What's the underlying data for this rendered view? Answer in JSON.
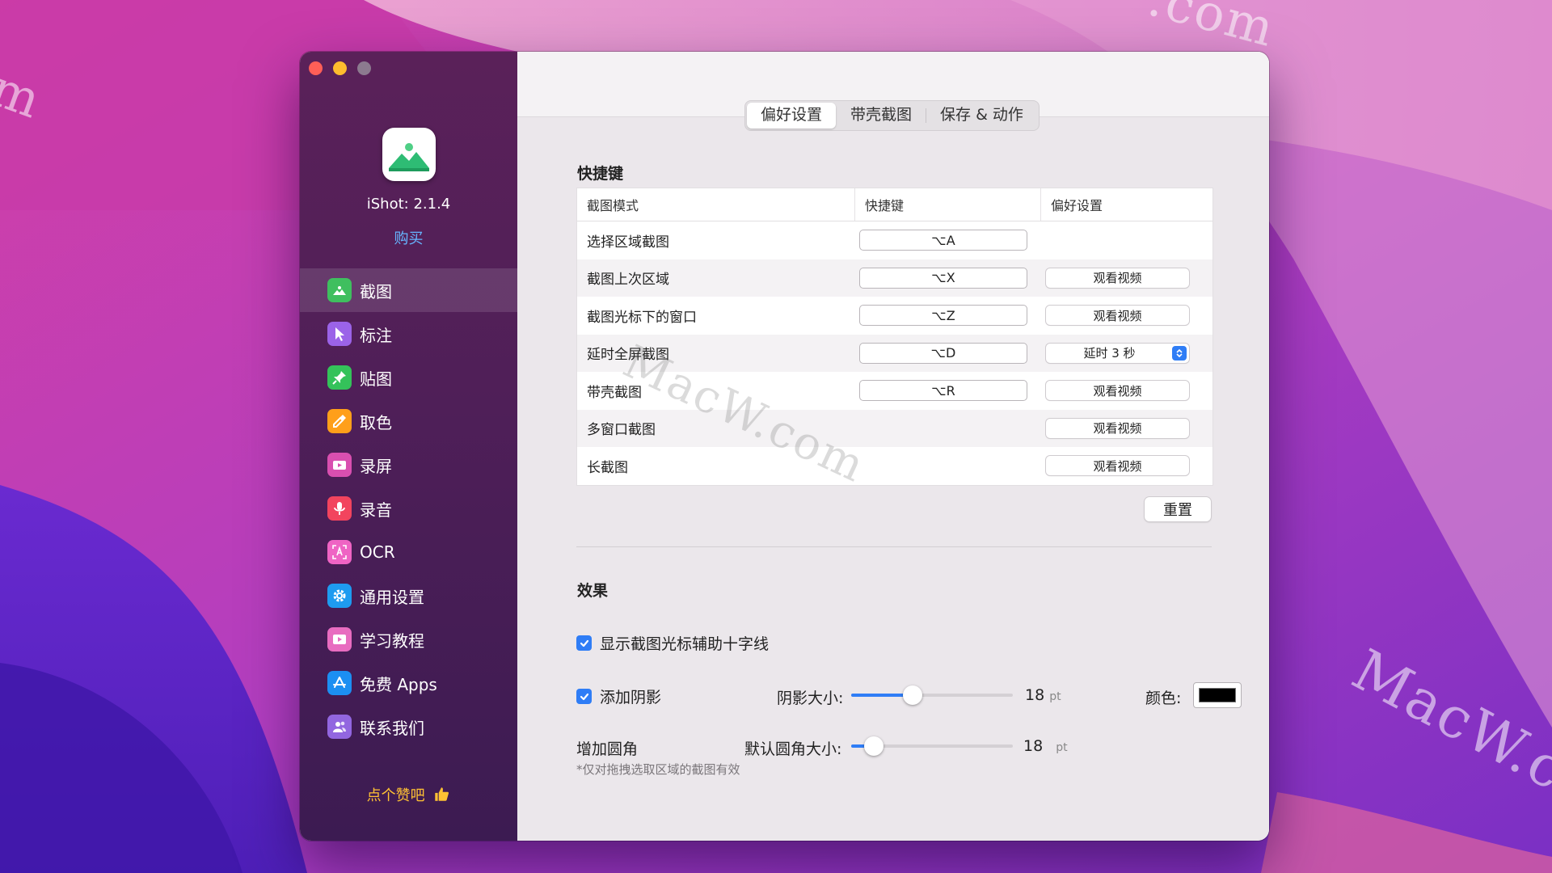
{
  "watermarks": [
    "m",
    ".com",
    "MacW.co",
    "MacW.com"
  ],
  "colors": {
    "accent": "#2f7df6",
    "link": "#66b6ff",
    "like": "#ffc233",
    "shadow_color": "#000000"
  },
  "app": {
    "version": "iShot: 2.1.4",
    "buy": "购买",
    "like": "点个赞吧"
  },
  "sidebar": {
    "items": [
      {
        "label": "截图",
        "icon": "image-icon",
        "color": "#3fbf5f",
        "active": true
      },
      {
        "label": "标注",
        "icon": "cursor-icon",
        "color": "#9b63e8"
      },
      {
        "label": "贴图",
        "icon": "pin-icon",
        "color": "#34c25a"
      },
      {
        "label": "取色",
        "icon": "eyedropper-icon",
        "color": "#ff9f1a"
      },
      {
        "label": "录屏",
        "icon": "video-icon",
        "color": "#d94fb0"
      },
      {
        "label": "录音",
        "icon": "microphone-icon",
        "color": "#f2445e"
      },
      {
        "label": "OCR",
        "icon": "ocr-icon",
        "color": "#ef64c4"
      },
      {
        "label": "通用设置",
        "icon": "gear-icon",
        "color": "#1e9bf0"
      },
      {
        "label": "学习教程",
        "icon": "tutorial-icon",
        "color": "#e86cc0"
      },
      {
        "label": "免费 Apps",
        "icon": "app-store-icon",
        "color": "#1c8ff2"
      },
      {
        "label": "联系我们",
        "icon": "contacts-icon",
        "color": "#9266e0"
      }
    ]
  },
  "tabs": [
    "偏好设置",
    "带壳截图",
    "保存 & 动作"
  ],
  "shortcuts": {
    "title": "快捷键",
    "headers": [
      "截图模式",
      "快捷键",
      "偏好设置"
    ],
    "rows": [
      {
        "mode": "选择区域截图",
        "key": "⌥A",
        "pref": ""
      },
      {
        "mode": "截图上次区域",
        "key": "⌥X",
        "pref": "观看视频"
      },
      {
        "mode": "截图光标下的窗口",
        "key": "⌥Z",
        "pref": "观看视频"
      },
      {
        "mode": "延时全屏截图",
        "key": "⌥D",
        "pref": "延时 3 秒",
        "pref_type": "select"
      },
      {
        "mode": "带壳截图",
        "key": "⌥R",
        "pref": "观看视频"
      },
      {
        "mode": "多窗口截图",
        "key": "",
        "pref": "观看视频"
      },
      {
        "mode": "长截图",
        "key": "",
        "pref": "观看视频"
      }
    ],
    "reset": "重置"
  },
  "effects": {
    "title": "效果",
    "crosshair": {
      "label": "显示截图光标辅助十字线",
      "checked": true
    },
    "shadow": {
      "label": "添加阴影",
      "checked": true,
      "size_label": "阴影大小:",
      "size_value": "18",
      "unit": "pt",
      "size_fraction": 0.38,
      "color_label": "颜色:"
    },
    "corner": {
      "label": "增加圆角",
      "size_label": "默认圆角大小:",
      "size_value": "18",
      "unit": "pt",
      "size_fraction": 0.14,
      "note": "*仅对拖拽选取区域的截图有效"
    }
  }
}
